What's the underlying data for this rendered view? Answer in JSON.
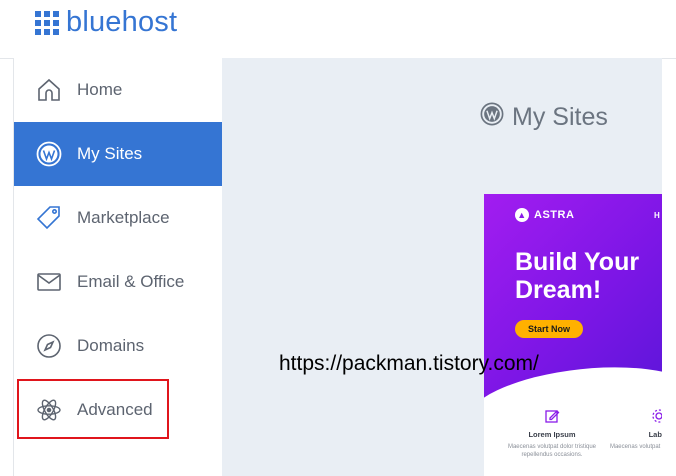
{
  "brand": {
    "name": "bluehost",
    "color": "#3575d3"
  },
  "sidebar": {
    "items": [
      {
        "label": "Home",
        "icon": "home-icon"
      },
      {
        "label": "My Sites",
        "icon": "wordpress-icon",
        "active": true
      },
      {
        "label": "Marketplace",
        "icon": "tag-icon"
      },
      {
        "label": "Email & Office",
        "icon": "envelope-icon"
      },
      {
        "label": "Domains",
        "icon": "compass-icon"
      },
      {
        "label": "Advanced",
        "icon": "atom-icon",
        "highlighted": true
      }
    ],
    "active_color": "#3575d3",
    "highlight_color": "#e0151c"
  },
  "main": {
    "title": "My Sites",
    "title_icon": "wordpress-icon",
    "site_card": {
      "brand": "ASTRA",
      "nav_letter": "H",
      "hero_title": "Build Your Dream!",
      "cta": "Start Now",
      "features": [
        {
          "title": "Lorem Ipsum",
          "desc": "Maecenas volutpat dolor tristique repellendus occasions.",
          "icon": "edit-icon"
        },
        {
          "title": "Labor",
          "desc": "Maecenas volutpat dolor repellendus",
          "icon": "gear-icon"
        }
      ],
      "hero_color": "#8a1be9",
      "cta_color": "#ffb100"
    }
  },
  "watermark": "https://packman.tistory.com/"
}
